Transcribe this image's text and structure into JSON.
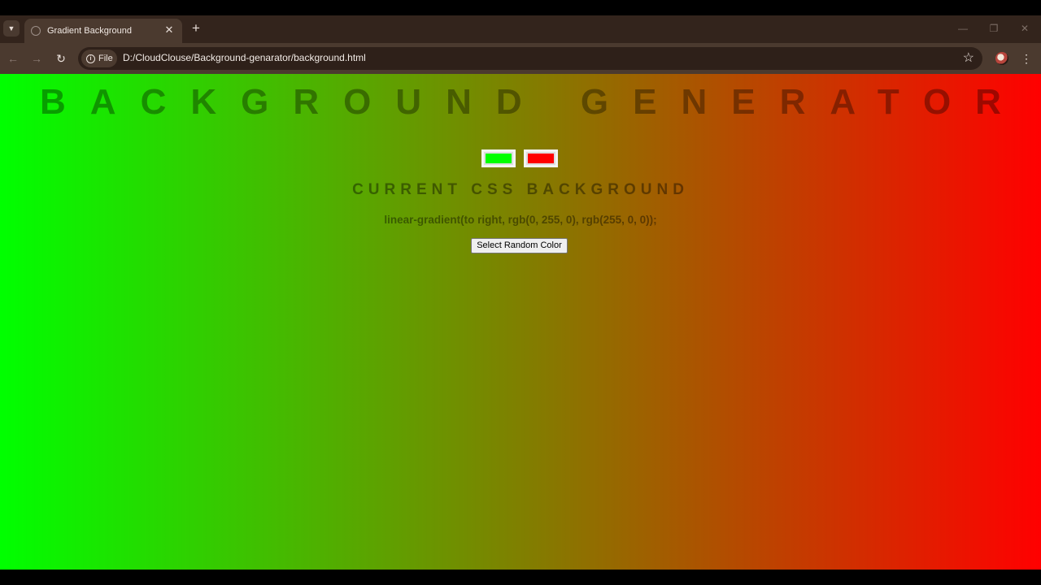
{
  "browser": {
    "tab": {
      "title": "Gradient Background"
    },
    "address": {
      "scheme_label": "File",
      "url": "D:/CloudClouse/Background-genarator/background.html"
    }
  },
  "page": {
    "title": "BACKGROUND GENERATOR",
    "subtitle": "CURRENT CSS BACKGROUND",
    "css_output": "linear-gradient(to right, rgb(0, 255, 0), rgb(255, 0, 0));",
    "color1": {
      "value": "#00ff00"
    },
    "color2": {
      "value": "#ff0000"
    },
    "random_button_label": "Select Random Color"
  },
  "colors": {
    "gradient_start": "#00ff00",
    "gradient_end": "#ff0000",
    "chrome_tabstrip": "#33241c",
    "chrome_toolbar": "#4b3a2f"
  },
  "icons": [
    "tab-search-icon",
    "globe-icon",
    "close-icon",
    "plus-icon",
    "minimize-icon",
    "maximize-icon",
    "back-arrow-icon",
    "forward-arrow-icon",
    "reload-icon",
    "info-icon",
    "star-icon",
    "avatar",
    "kebab-icon"
  ]
}
